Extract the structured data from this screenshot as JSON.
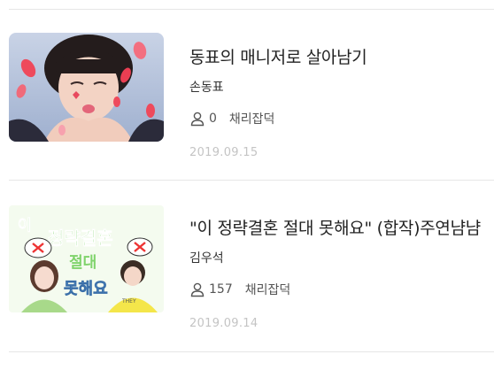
{
  "posts": [
    {
      "title": "동표의 매니저로 살아남기",
      "author": "손동표",
      "views": "0",
      "category": "채리잡덕",
      "date": "2019.09.15"
    },
    {
      "title": "\"이 정략결혼 절대 못해요\" (합작)주연냠냠",
      "author": "김우석",
      "views": "157",
      "category": "채리잡덕",
      "date": "2019.09.14",
      "cover_text": [
        "이",
        "정략결혼",
        "절대",
        "못해요"
      ]
    }
  ],
  "colors": {
    "divider": "#e6e6e6",
    "date": "#c4c4c4",
    "title": "#222222"
  }
}
